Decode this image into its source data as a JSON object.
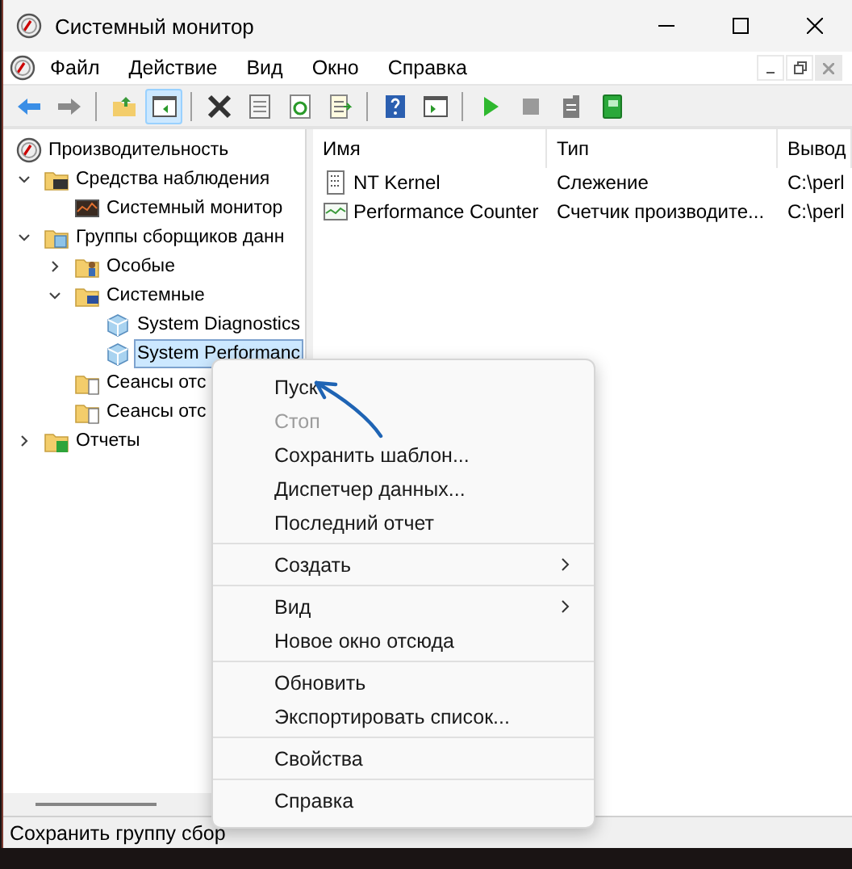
{
  "window": {
    "title": "Системный монитор"
  },
  "menu_bar": [
    "Файл",
    "Действие",
    "Вид",
    "Окно",
    "Справка"
  ],
  "toolbar": {
    "buttons": [
      {
        "pressed": false
      },
      {
        "pressed": false
      },
      {
        "pressed": false
      },
      {
        "pressed": true
      },
      {
        "pressed": false
      },
      {
        "pressed": false
      },
      {
        "pressed": false
      },
      {
        "pressed": false
      },
      {
        "pressed": false
      },
      {
        "pressed": false
      },
      {
        "pressed": false
      },
      {
        "pressed": false
      },
      {
        "pressed": false
      },
      {
        "pressed": false
      }
    ]
  },
  "tree": [
    {
      "label": "Производительность",
      "kind": "root",
      "selected": false,
      "children": [
        {
          "label": "Средства наблюдения",
          "kind": "folder-monitor",
          "expanded": true,
          "selected": false,
          "children": [
            {
              "label": "Системный монитор",
              "kind": "monitor",
              "selected": false
            }
          ]
        },
        {
          "label": "Группы сборщиков данн",
          "kind": "folder-collector",
          "expanded": true,
          "selected": false,
          "children": [
            {
              "label": "Особые",
              "kind": "folder-user",
              "expanded": false,
              "selected": false
            },
            {
              "label": "Системные",
              "kind": "folder-system",
              "expanded": true,
              "selected": false,
              "children": [
                {
                  "label": "System Diagnostics",
                  "kind": "collector",
                  "selected": false
                },
                {
                  "label": "System Performanc",
                  "kind": "collector",
                  "selected": true
                }
              ]
            },
            {
              "label": "Сеансы отс",
              "kind": "folder-trace",
              "selected": false
            },
            {
              "label": "Сеансы отс",
              "kind": "folder-trace",
              "selected": false
            }
          ]
        },
        {
          "label": "Отчеты",
          "kind": "folder-report",
          "expanded": false,
          "selected": false
        }
      ]
    }
  ],
  "list": {
    "columns": [
      "Имя",
      "Тип",
      "Вывод"
    ],
    "rows": [
      {
        "kind": "trace",
        "cells": [
          "NT Kernel",
          "Слежение",
          "C:\\perl"
        ]
      },
      {
        "kind": "counter",
        "cells": [
          "Performance Counter",
          "Счетчик производите...",
          "C:\\perl"
        ]
      }
    ]
  },
  "status_bar": "Сохранить группу сбор",
  "context_menu": {
    "groups": [
      [
        {
          "label": "Пуск",
          "disabled": false
        },
        {
          "label": "Стоп",
          "disabled": true
        },
        {
          "label": "Сохранить шаблон...",
          "disabled": false
        },
        {
          "label": "Диспетчер данных...",
          "disabled": false
        },
        {
          "label": "Последний отчет",
          "disabled": false
        }
      ],
      [
        {
          "label": "Создать",
          "disabled": false,
          "submenu": true
        }
      ],
      [
        {
          "label": "Вид",
          "disabled": false,
          "submenu": true
        },
        {
          "label": "Новое окно отсюда",
          "disabled": false
        }
      ],
      [
        {
          "label": "Обновить",
          "disabled": false
        },
        {
          "label": "Экспортировать список...",
          "disabled": false
        }
      ],
      [
        {
          "label": "Свойства",
          "disabled": false
        }
      ],
      [
        {
          "label": "Справка",
          "disabled": false
        }
      ]
    ]
  }
}
